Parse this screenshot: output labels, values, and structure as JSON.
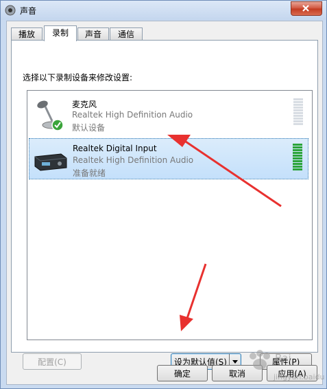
{
  "window": {
    "title": "声音"
  },
  "tabs": [
    {
      "label": "播放"
    },
    {
      "label": "录制",
      "active": true
    },
    {
      "label": "声音"
    },
    {
      "label": "通信"
    }
  ],
  "instruction": "选择以下录制设备来修改设置:",
  "devices": [
    {
      "name": "麦克风",
      "description": "Realtek High Definition Audio",
      "status": "默认设备",
      "icon": "microphone-default-icon",
      "selected": false,
      "level_active": false
    },
    {
      "name": "Realtek Digital Input",
      "description": "Realtek High Definition Audio",
      "status": "准备就绪",
      "icon": "digital-input-device-icon",
      "selected": true,
      "level_active": true
    }
  ],
  "buttons": {
    "configure": "配置(C)",
    "set_default": "设为默认值(S)",
    "properties": "属性(P)",
    "ok": "确定",
    "cancel": "取消",
    "apply": "应用(A)"
  },
  "annotation": {
    "arrow_color": "#e8312f"
  }
}
